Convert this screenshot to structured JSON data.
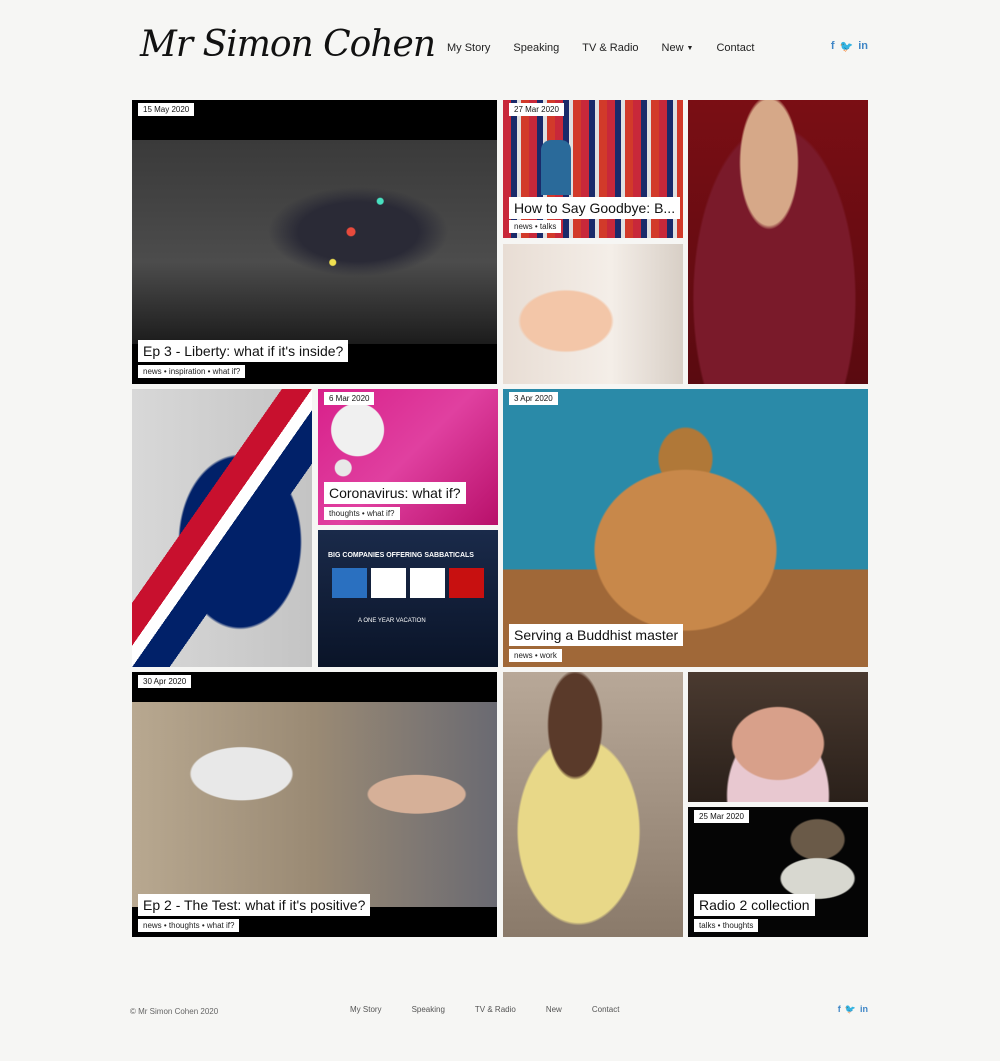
{
  "header": {
    "logo_text": "Mr Simon Cohen",
    "nav": [
      {
        "label": "My Story"
      },
      {
        "label": "Speaking"
      },
      {
        "label": "TV & Radio"
      },
      {
        "label": "New"
      },
      {
        "label": "Contact"
      }
    ],
    "social": {
      "facebook": "f",
      "twitter": "🐦",
      "linkedin": "in"
    }
  },
  "tiles": {
    "liberty": {
      "date": "15 May 2020",
      "title": "Ep 3 - Liberty: what if it's inside?",
      "tags": "news • inspiration • what if?"
    },
    "goodbye": {
      "date": "27 Mar 2020",
      "title": "How to Say Goodbye: B...",
      "tags": "news • talks"
    },
    "coronavirus": {
      "date": "6 Mar 2020",
      "title": "Coronavirus: what if?",
      "tags": "thoughts • what if?"
    },
    "buddhist": {
      "date": "3 Apr 2020",
      "title": "Serving a Buddhist master",
      "tags": "news • work"
    },
    "test": {
      "date": "30 Apr 2020",
      "title": "Ep 2 - The Test: what if it's positive?",
      "tags": "news • thoughts • what if?"
    },
    "radio2": {
      "date": "25 Mar 2020",
      "title": "Radio 2 collection",
      "tags": "talks • thoughts"
    },
    "sabbaticals": {
      "headline": "BIG COMPANIES OFFERING SABBATICALS",
      "sub": "A ONE YEAR VACATION"
    }
  },
  "footer": {
    "copyright": "© Mr Simon Cohen 2020",
    "nav": [
      "My Story",
      "Speaking",
      "TV & Radio",
      "New",
      "Contact"
    ]
  },
  "colors": {
    "accent": "#3f86c6",
    "background": "#f6f6f4"
  }
}
